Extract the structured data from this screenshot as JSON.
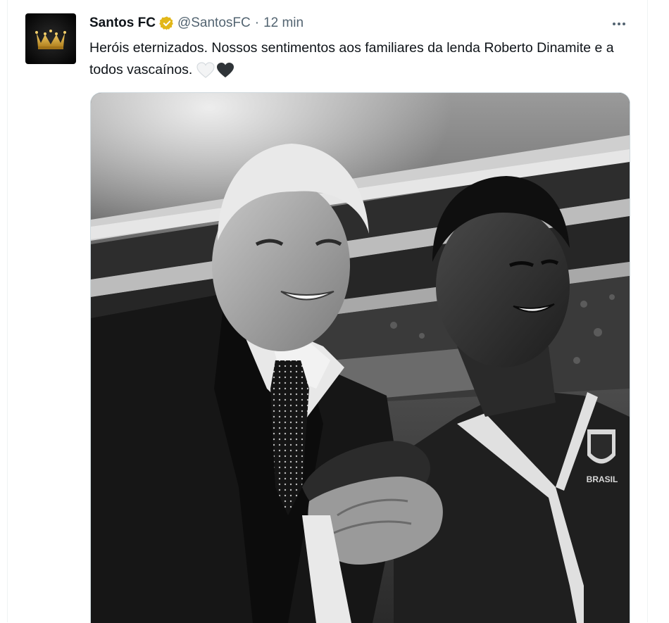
{
  "tweet": {
    "display_name": "Santos FC",
    "handle": "@SantosFC",
    "separator": "·",
    "time": "12 min",
    "text": "Heróis eternizados. Nossos sentimentos aos familiares da lenda Roberto Dinamite e a todos vascaínos.",
    "hearts": [
      "white-heart-emoji",
      "black-heart-emoji"
    ],
    "photo_text": "BRASIL"
  },
  "icons": {
    "verified": "verified-gold-badge-icon",
    "more": "more-horizontal-icon",
    "avatar": "crown-icon"
  },
  "colors": {
    "verified_badge": "#e2b719",
    "muted_text": "#536471",
    "primary_text": "#0f1419",
    "crown": "#d9a72f"
  }
}
